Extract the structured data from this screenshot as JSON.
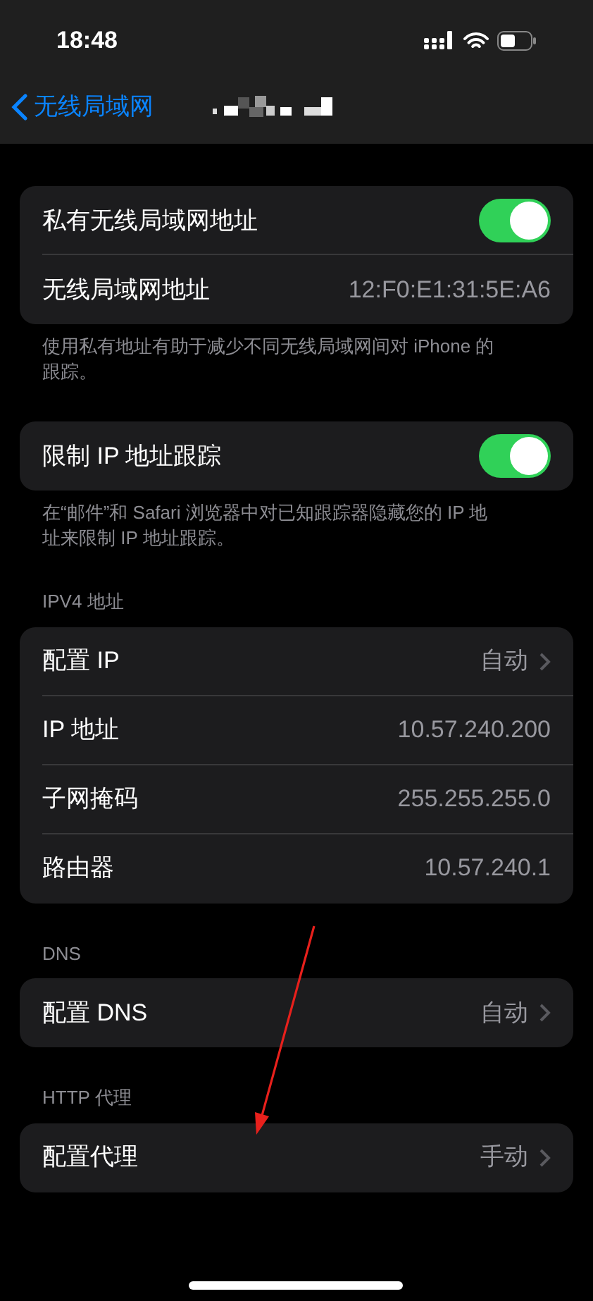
{
  "status_bar": {
    "time": "18:48"
  },
  "nav": {
    "back_label": "无线局域网"
  },
  "sections": [
    {
      "rows": [
        {
          "kind": "toggle",
          "label": "私有无线局域网地址",
          "on": true
        },
        {
          "kind": "value",
          "label": "无线局域网地址",
          "value": "12:F0:E1:31:5E:A6"
        }
      ],
      "footer": "使用私有地址有助于减少不同无线局域网间对 iPhone 的跟踪。"
    },
    {
      "rows": [
        {
          "kind": "toggle",
          "label": "限制 IP 地址跟踪",
          "on": true
        }
      ],
      "footer": "在“邮件”和 Safari 浏览器中对已知跟踪器隐藏您的 IP 地址来限制 IP 地址跟踪。"
    },
    {
      "header": "IPV4 地址",
      "rows": [
        {
          "kind": "disclosure",
          "label": "配置 IP",
          "value": "自动"
        },
        {
          "kind": "value",
          "label": "IP 地址",
          "value": "10.57.240.200"
        },
        {
          "kind": "value",
          "label": "子网掩码",
          "value": "255.255.255.0"
        },
        {
          "kind": "value",
          "label": "路由器",
          "value": "10.57.240.1"
        }
      ]
    },
    {
      "header": "DNS",
      "rows": [
        {
          "kind": "disclosure",
          "label": "配置 DNS",
          "value": "自动"
        }
      ]
    },
    {
      "header": "HTTP 代理",
      "rows": [
        {
          "kind": "disclosure",
          "label": "配置代理",
          "value": "手动"
        }
      ]
    }
  ]
}
